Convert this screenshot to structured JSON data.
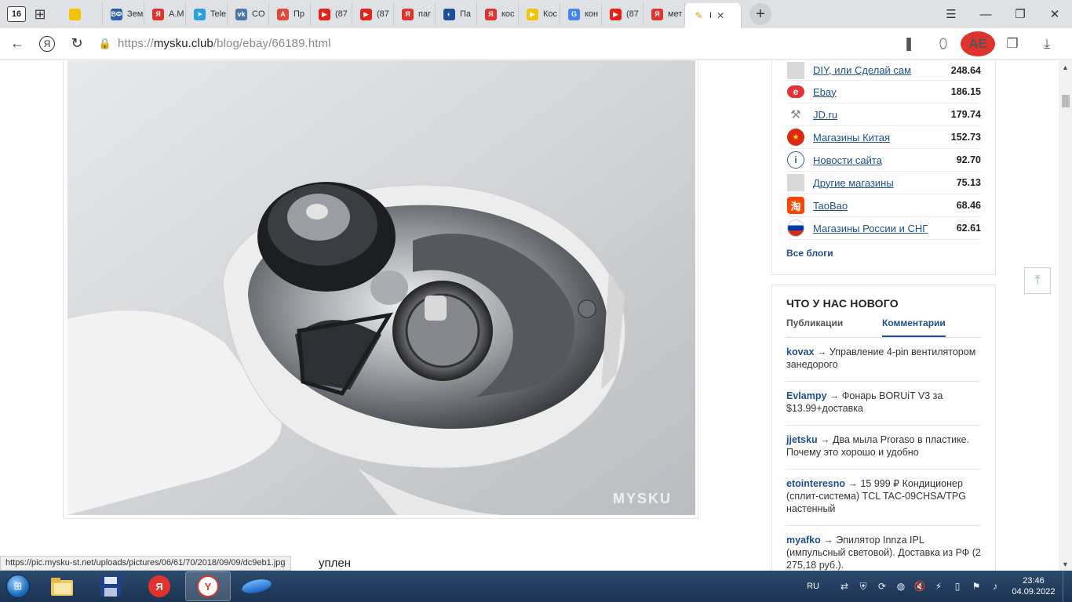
{
  "browser": {
    "home_counter": "16",
    "tabs": [
      {
        "label": "",
        "icon": "yandex-video-icon",
        "color": "#f5c400"
      },
      {
        "label": "Зем",
        "icon": "vf-icon",
        "badge": "ВФ",
        "color": "#2b5fb4"
      },
      {
        "label": "A.M",
        "icon": "yandex-icon",
        "badge": "Я",
        "color": "#e0332e"
      },
      {
        "label": "Tele",
        "icon": "telegram-icon",
        "badge": "➤",
        "color": "#2aa1da"
      },
      {
        "label": "CO",
        "icon": "vk-icon",
        "badge": "vk",
        "color": "#4a76a8"
      },
      {
        "label": "Пр",
        "icon": "pdf-icon",
        "badge": "A",
        "color": "#e3473a"
      },
      {
        "label": "(87",
        "icon": "youtube-icon",
        "badge": "▶",
        "color": "#e62117"
      },
      {
        "label": "(87",
        "icon": "youtube-icon",
        "badge": "▶",
        "color": "#e62117"
      },
      {
        "label": "паг",
        "icon": "yandex-icon",
        "badge": "Я",
        "color": "#e0332e"
      },
      {
        "label": "Па",
        "icon": "globe-icon",
        "badge": "◐",
        "color": "#1f4f9b"
      },
      {
        "label": "кос",
        "icon": "yandex-icon",
        "badge": "Я",
        "color": "#e0332e"
      },
      {
        "label": "Кос",
        "icon": "yandex-video-icon",
        "badge": "▶",
        "color": "#f5c400"
      },
      {
        "label": "кон",
        "icon": "google-icon",
        "badge": "G",
        "color": "#4285f4"
      },
      {
        "label": "(87",
        "icon": "youtube-icon",
        "badge": "▶",
        "color": "#e62117"
      },
      {
        "label": "мет",
        "icon": "yandex-icon",
        "badge": "Я",
        "color": "#e0332e"
      }
    ],
    "active_tab": {
      "label": "I",
      "icon": "pencil-icon",
      "close": "✕"
    },
    "new_tab": "+",
    "window_controls": {
      "menu": "☰",
      "minimize": "—",
      "restore": "❐",
      "close": "✕"
    },
    "address": {
      "scheme": "https://",
      "host": "mysku.club",
      "path": "/blog/ebay/66189.html"
    },
    "ext_badge": "AE"
  },
  "photo": {
    "watermark": "MYSKU"
  },
  "status_url": "https://pic.mysku-st.net/uploads/pictures/06/61/70/2018/09/09/dc9eb1.jpg",
  "article_fragment": "уплен",
  "blogs": {
    "rows": [
      {
        "name": "DIY, или Сделай сам",
        "rate": "248.64",
        "icon": "placeholder-icon"
      },
      {
        "name": "Ebay",
        "rate": "186.15",
        "icon": "ebay-icon"
      },
      {
        "name": "JD.ru",
        "rate": "179.74",
        "icon": "jd-icon"
      },
      {
        "name": "Магазины Китая",
        "rate": "152.73",
        "icon": "china-flag-icon"
      },
      {
        "name": "Новости сайта",
        "rate": "92.70",
        "icon": "info-icon"
      },
      {
        "name": "Другие магазины",
        "rate": "75.13",
        "icon": "placeholder-icon"
      },
      {
        "name": "TaoBao",
        "rate": "68.46",
        "icon": "taobao-icon"
      },
      {
        "name": "Магазины России и СНГ",
        "rate": "62.61",
        "icon": "russia-flag-icon"
      }
    ],
    "all_label": "Все блоги"
  },
  "whats_new": {
    "title": "ЧТО У НАС НОВОГО",
    "tab_publications": "Публикации",
    "tab_comments": "Комментарии",
    "comments": [
      {
        "user": "kovax",
        "text": " → Управление 4-pin вентилятором занедорого"
      },
      {
        "user": "Evlampy",
        "text": " → Фонарь BORUiT V3 за $13.99+доставка"
      },
      {
        "user": "jjetsku",
        "text": " → Два мыла Proraso в пластике. Почему это хорошо и удобно"
      },
      {
        "user": "etointeresno",
        "text": " → 15 999 ₽ Кондиционер (сплит-система) TCL TAC-09CHSA/TPG настенный"
      },
      {
        "user": "myafko",
        "text": " → Эпилятор Innza IPL (импульсный световой). Доставка из РФ (2 275,18 руб.)."
      }
    ]
  },
  "taskbar": {
    "lang": "RU",
    "time": "23:46",
    "date": "04.09.2022"
  }
}
